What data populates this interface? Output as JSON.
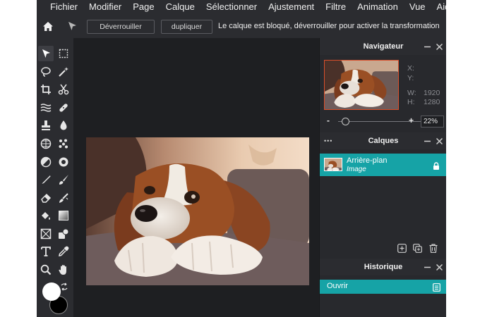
{
  "menu": {
    "items": [
      "Fichier",
      "Modifier",
      "Page",
      "Calque",
      "Sélectionner",
      "Ajustement",
      "Filtre",
      "Animation",
      "Vue",
      "Aide"
    ]
  },
  "toolbar": {
    "unlock_label": "Déverrouiller",
    "duplicate_label": "dupliquer",
    "message": "Le calque est bloqué, déverrouiller pour activer la transformation"
  },
  "tools": {
    "icons": [
      "move-icon",
      "marquee-icon",
      "lasso-icon",
      "magic-wand-icon",
      "crop-icon",
      "scissors-icon",
      "liquify-icon",
      "bandage-icon",
      "stamp-icon",
      "drop-icon",
      "sphere-icon",
      "scatter-icon",
      "dodge-icon",
      "sponge-icon",
      "pen-icon",
      "brush-icon",
      "eraser-icon",
      "smudge-icon",
      "bucket-icon",
      "gradient-icon",
      "frame-icon",
      "shape-icon",
      "text-icon",
      "eyedropper-icon",
      "zoom-icon",
      "hand-icon"
    ],
    "foreground_color": "#ffffff",
    "background_color": "#000000"
  },
  "navigator": {
    "title": "Navigateur",
    "x_label": "X:",
    "y_label": "Y:",
    "w_label": "W:",
    "w_value": "1920",
    "h_label": "H:",
    "h_value": "1280",
    "minus": "-",
    "plus": "+",
    "zoom_value": "22%",
    "zoom_fraction": 0.05
  },
  "layers": {
    "title": "Calques",
    "menu_dots": "•••",
    "items": [
      {
        "name": "Arrière-plan",
        "type": "Image",
        "locked": true
      }
    ]
  },
  "history": {
    "title": "Historique",
    "items": [
      {
        "label": "Ouvrir"
      }
    ]
  },
  "colors": {
    "accent": "#16a3a6",
    "panel_bg": "#28292d",
    "workspace_bg": "#1e1f22"
  }
}
